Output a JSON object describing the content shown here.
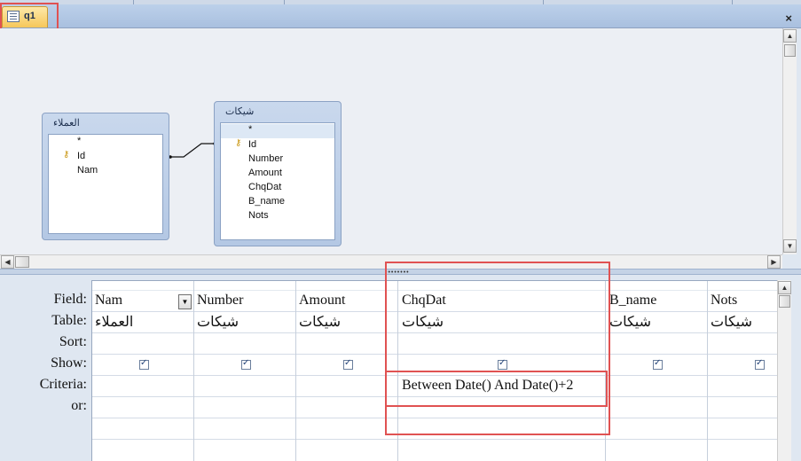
{
  "document_tab": {
    "label": "q1",
    "icon": "query-icon"
  },
  "close_label": "×",
  "tables": [
    {
      "title": "العملاء",
      "fields": [
        {
          "label": "*"
        },
        {
          "label": "Id",
          "key": true
        },
        {
          "label": "Nam"
        }
      ]
    },
    {
      "title": "شيكات",
      "fields": [
        {
          "label": "*"
        },
        {
          "label": "Id",
          "key": true
        },
        {
          "label": "Number"
        },
        {
          "label": "Amount"
        },
        {
          "label": "ChqDat"
        },
        {
          "label": "B_name"
        },
        {
          "label": "Nots"
        }
      ]
    }
  ],
  "row_labels": {
    "field": "Field:",
    "table": "Table:",
    "sort": "Sort:",
    "show": "Show:",
    "criteria": "Criteria:",
    "or": "or:"
  },
  "columns": [
    {
      "field": "Nam",
      "table": "العملاء",
      "show": true,
      "criteria": ""
    },
    {
      "field": "Number",
      "table": "شيكات",
      "show": true,
      "criteria": ""
    },
    {
      "field": "Amount",
      "table": "شيكات",
      "show": true,
      "criteria": ""
    },
    {
      "field": "ChqDat",
      "table": "شيكات",
      "show": true,
      "criteria": "Between Date() And Date()+2"
    },
    {
      "field": "B_name",
      "table": "شيكات",
      "show": true,
      "criteria": ""
    },
    {
      "field": "Nots",
      "table": "شيكات",
      "show": true,
      "criteria": ""
    }
  ],
  "colors": {
    "tab_active": "#f6c75a",
    "highlight_box": "#e05252",
    "table_box": "#b4c8e4"
  }
}
